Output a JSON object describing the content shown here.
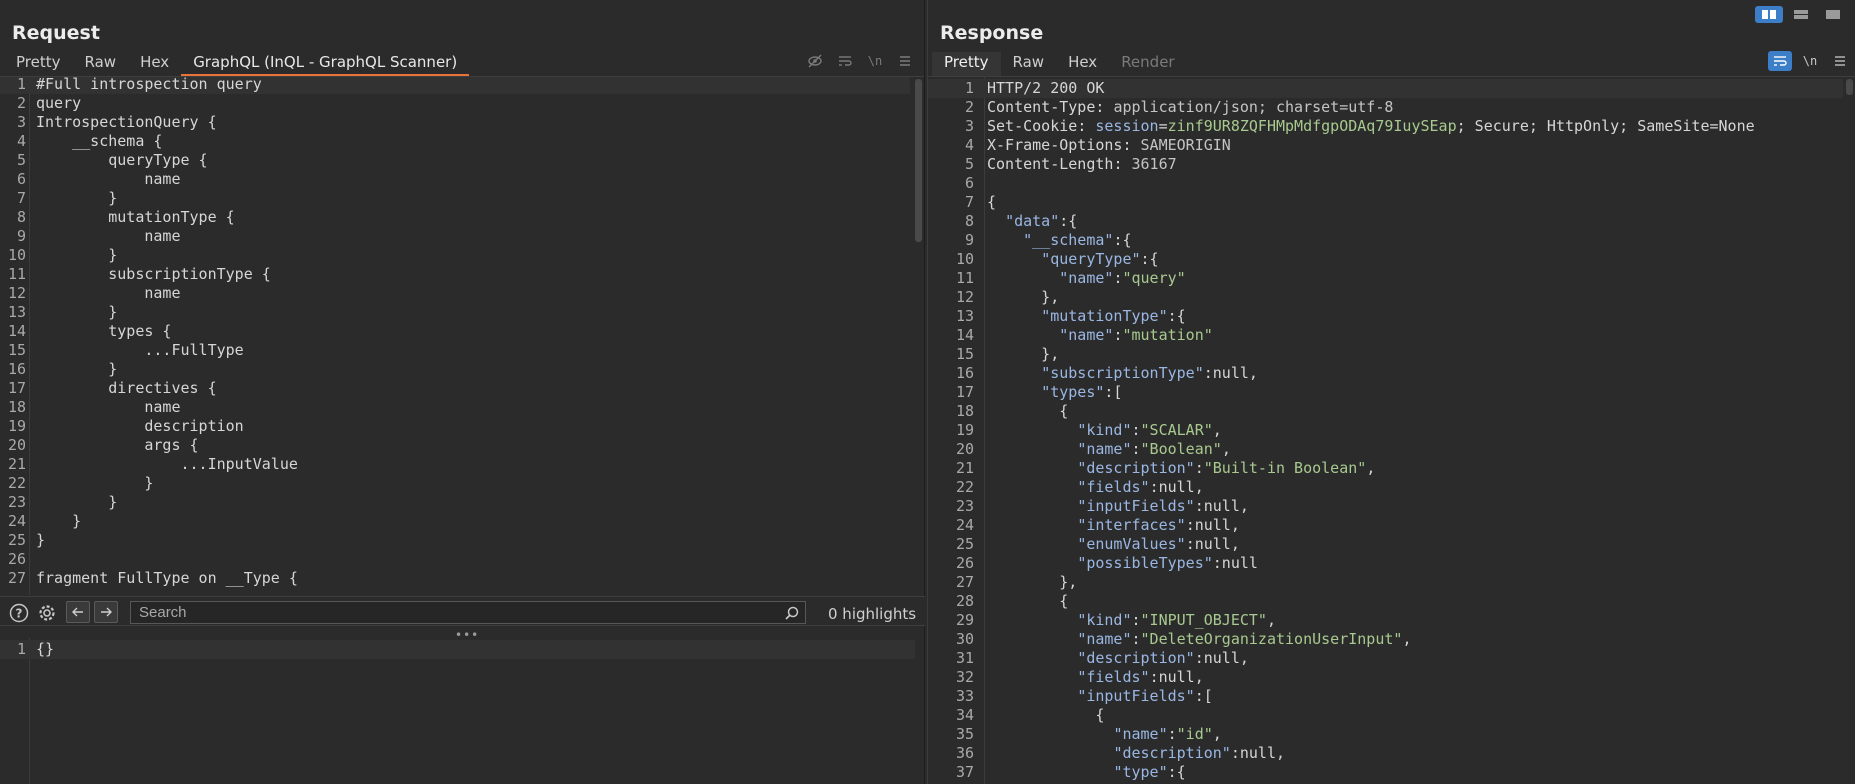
{
  "request": {
    "title": "Request",
    "tabs": [
      {
        "label": "Pretty"
      },
      {
        "label": "Raw"
      },
      {
        "label": "Hex"
      },
      {
        "label": "GraphQL (InQL - GraphQL Scanner)"
      }
    ],
    "active_tab": "GraphQL (InQL - GraphQL Scanner)",
    "tool_icons": [
      "eye-slash-icon",
      "wrap-icon",
      "newline-icon",
      "menu-icon"
    ],
    "code_lines": [
      "#Full introspection query",
      "query",
      "IntrospectionQuery {",
      "    __schema {",
      "        queryType {",
      "            name",
      "        }",
      "        mutationType {",
      "            name",
      "        }",
      "        subscriptionType {",
      "            name",
      "        }",
      "        types {",
      "            ...FullType",
      "        }",
      "        directives {",
      "            name",
      "            description",
      "            args {",
      "                ...InputValue",
      "            }",
      "        }",
      "    }",
      "}",
      "",
      "fragment FullType on __Type {"
    ],
    "search": {
      "placeholder": "Search",
      "highlights": "0 highlights"
    },
    "variables_lines": [
      "{}"
    ]
  },
  "response": {
    "title": "Response",
    "tabs": [
      {
        "label": "Pretty"
      },
      {
        "label": "Raw"
      },
      {
        "label": "Hex"
      },
      {
        "label": "Render"
      }
    ],
    "active_tab": "Pretty",
    "tool_icons": [
      "wrap-icon",
      "newline-icon",
      "menu-icon"
    ],
    "headers": [
      {
        "name": "HTTP/2 200 OK",
        "value": ""
      },
      {
        "name": "Content-Type",
        "value": "application/json; charset=utf-8"
      },
      {
        "name": "Set-Cookie",
        "value_cookie_key": "session",
        "value_cookie_val": "zinf9UR8ZQFHMpMdfgpODAq79IuySEap",
        "value_rest": "; Secure; HttpOnly; SameSite=None"
      },
      {
        "name": "X-Frame-Options",
        "value": "SAMEORIGIN"
      },
      {
        "name": "Content-Length",
        "value": "36167"
      }
    ],
    "body_lines": [
      [
        [
          "p",
          "{"
        ]
      ],
      [
        [
          "p",
          "  "
        ],
        [
          "k",
          "\"data\""
        ],
        [
          "p",
          ":{"
        ]
      ],
      [
        [
          "p",
          "    "
        ],
        [
          "k",
          "\"__schema\""
        ],
        [
          "p",
          ":{"
        ]
      ],
      [
        [
          "p",
          "      "
        ],
        [
          "k",
          "\"queryType\""
        ],
        [
          "p",
          ":{"
        ]
      ],
      [
        [
          "p",
          "        "
        ],
        [
          "k",
          "\"name\""
        ],
        [
          "p",
          ":"
        ],
        [
          "s",
          "\"query\""
        ]
      ],
      [
        [
          "p",
          "      },"
        ]
      ],
      [
        [
          "p",
          "      "
        ],
        [
          "k",
          "\"mutationType\""
        ],
        [
          "p",
          ":{"
        ]
      ],
      [
        [
          "p",
          "        "
        ],
        [
          "k",
          "\"name\""
        ],
        [
          "p",
          ":"
        ],
        [
          "s",
          "\"mutation\""
        ]
      ],
      [
        [
          "p",
          "      },"
        ]
      ],
      [
        [
          "p",
          "      "
        ],
        [
          "k",
          "\"subscriptionType\""
        ],
        [
          "p",
          ":null,"
        ]
      ],
      [
        [
          "p",
          "      "
        ],
        [
          "k",
          "\"types\""
        ],
        [
          "p",
          ":["
        ]
      ],
      [
        [
          "p",
          "        {"
        ]
      ],
      [
        [
          "p",
          "          "
        ],
        [
          "k",
          "\"kind\""
        ],
        [
          "p",
          ":"
        ],
        [
          "s",
          "\"SCALAR\""
        ],
        [
          "p",
          ","
        ]
      ],
      [
        [
          "p",
          "          "
        ],
        [
          "k",
          "\"name\""
        ],
        [
          "p",
          ":"
        ],
        [
          "s",
          "\"Boolean\""
        ],
        [
          "p",
          ","
        ]
      ],
      [
        [
          "p",
          "          "
        ],
        [
          "k",
          "\"description\""
        ],
        [
          "p",
          ":"
        ],
        [
          "s",
          "\"Built-in Boolean\""
        ],
        [
          "p",
          ","
        ]
      ],
      [
        [
          "p",
          "          "
        ],
        [
          "k",
          "\"fields\""
        ],
        [
          "p",
          ":null,"
        ]
      ],
      [
        [
          "p",
          "          "
        ],
        [
          "k",
          "\"inputFields\""
        ],
        [
          "p",
          ":null,"
        ]
      ],
      [
        [
          "p",
          "          "
        ],
        [
          "k",
          "\"interfaces\""
        ],
        [
          "p",
          ":null,"
        ]
      ],
      [
        [
          "p",
          "          "
        ],
        [
          "k",
          "\"enumValues\""
        ],
        [
          "p",
          ":null,"
        ]
      ],
      [
        [
          "p",
          "          "
        ],
        [
          "k",
          "\"possibleTypes\""
        ],
        [
          "p",
          ":null"
        ]
      ],
      [
        [
          "p",
          "        },"
        ]
      ],
      [
        [
          "p",
          "        {"
        ]
      ],
      [
        [
          "p",
          "          "
        ],
        [
          "k",
          "\"kind\""
        ],
        [
          "p",
          ":"
        ],
        [
          "s",
          "\"INPUT_OBJECT\""
        ],
        [
          "p",
          ","
        ]
      ],
      [
        [
          "p",
          "          "
        ],
        [
          "k",
          "\"name\""
        ],
        [
          "p",
          ":"
        ],
        [
          "s",
          "\"DeleteOrganizationUserInput\""
        ],
        [
          "p",
          ","
        ]
      ],
      [
        [
          "p",
          "          "
        ],
        [
          "k",
          "\"description\""
        ],
        [
          "p",
          ":null,"
        ]
      ],
      [
        [
          "p",
          "          "
        ],
        [
          "k",
          "\"fields\""
        ],
        [
          "p",
          ":null,"
        ]
      ],
      [
        [
          "p",
          "          "
        ],
        [
          "k",
          "\"inputFields\""
        ],
        [
          "p",
          ":["
        ]
      ],
      [
        [
          "p",
          "            {"
        ]
      ],
      [
        [
          "p",
          "              "
        ],
        [
          "k",
          "\"name\""
        ],
        [
          "p",
          ":"
        ],
        [
          "s",
          "\"id\""
        ],
        [
          "p",
          ","
        ]
      ],
      [
        [
          "p",
          "              "
        ],
        [
          "k",
          "\"description\""
        ],
        [
          "p",
          ":null,"
        ]
      ],
      [
        [
          "p",
          "              "
        ],
        [
          "k",
          "\"type\""
        ],
        [
          "p",
          ":{"
        ]
      ]
    ]
  }
}
